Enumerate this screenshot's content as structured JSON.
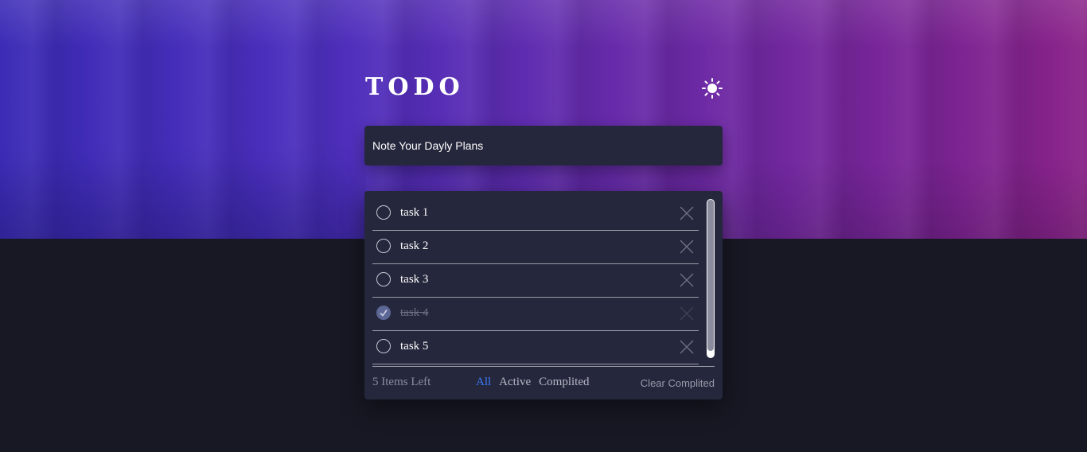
{
  "app": {
    "title": "TODO",
    "theme_icon": "sun-icon"
  },
  "input": {
    "placeholder": "Note Your Dayly Plans",
    "value": ""
  },
  "tasks": [
    {
      "text": "task 1",
      "completed": false
    },
    {
      "text": "task 2",
      "completed": false
    },
    {
      "text": "task 3",
      "completed": false
    },
    {
      "text": "task 4",
      "completed": true
    },
    {
      "text": "task 5",
      "completed": false
    }
  ],
  "footer": {
    "items_left": "5 Items Left",
    "filters": {
      "all": "All",
      "active": "Active",
      "completed": "Complited"
    },
    "active_filter": "all",
    "clear_label": "Clear Complited"
  },
  "colors": {
    "accent": "#3a7bfd",
    "card": "#25273c",
    "page_bg": "#181824"
  }
}
